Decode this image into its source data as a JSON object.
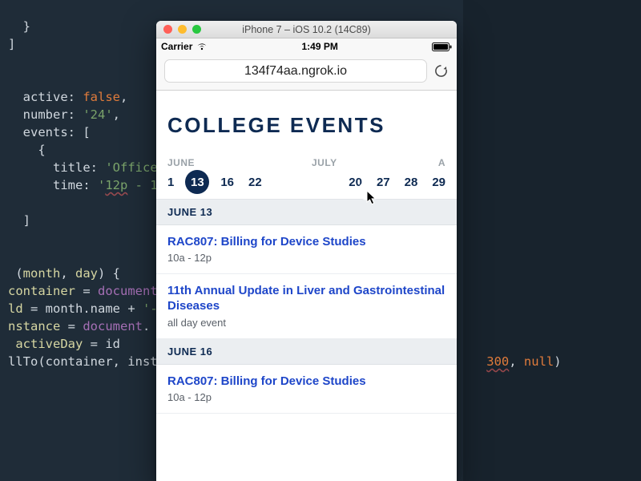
{
  "editor": {
    "l1": "  }",
    "l2": "]",
    "l3": "",
    "l4": "",
    "active_key": "  active",
    "active_val": "false",
    "comma": ",",
    "number_key": "  number",
    "number_val": "'24'",
    "events_key": "  events",
    "events_open": "[",
    "l8": "    {",
    "title_key": "      title",
    "title_val": "'Office",
    "time_key": "      time",
    "time_val_a": "'",
    "time_val_num": "12p",
    "time_val_b": " - 1",
    "l11": "",
    "l12": "  ]",
    "l13": "",
    "l14": "",
    "fn_sig_a": " (",
    "fn_month": "month",
    "fn_sep": ", ",
    "fn_day": "day",
    "fn_sig_b": ") {",
    "container_key": "container",
    "eq": " = ",
    "document": "document",
    "dot": ".",
    "id_key": "ld",
    "month_name": "month.name",
    "plus": " + ",
    "dash_str": "'-",
    "instance_key": "nstance",
    "activeDay_key": " activeDay",
    "id_var": "id",
    "llto_fn": "llTo",
    "llto_args_a": "(container, inst",
    "llto_num": "300",
    "llto_args_b": ", ",
    "null": "null",
    "llto_close": ")"
  },
  "simulator": {
    "title": "iPhone 7 – iOS 10.2 (14C89)",
    "statusbar": {
      "carrier": "Carrier",
      "time": "1:49 PM"
    },
    "url": "134f74aa.ngrok.io"
  },
  "app": {
    "title": "COLLEGE EVENTS",
    "months": {
      "m1": "JUNE",
      "m2": "JULY",
      "m3": "A"
    },
    "june_days": [
      "1",
      "13",
      "16",
      "22"
    ],
    "july_days": [
      "20",
      "27",
      "28",
      "29"
    ],
    "selected_day_index": 1,
    "sections": [
      {
        "label": "JUNE 13",
        "events": [
          {
            "title": "RAC807: Billing for Device Studies",
            "time": "10a - 12p"
          },
          {
            "title": "11th Annual Update in Liver and Gastrointestinal Diseases",
            "time": "all day event"
          }
        ]
      },
      {
        "label": "JUNE 16",
        "events": [
          {
            "title": "RAC807: Billing for Device Studies",
            "time": "10a - 12p"
          }
        ]
      }
    ]
  }
}
